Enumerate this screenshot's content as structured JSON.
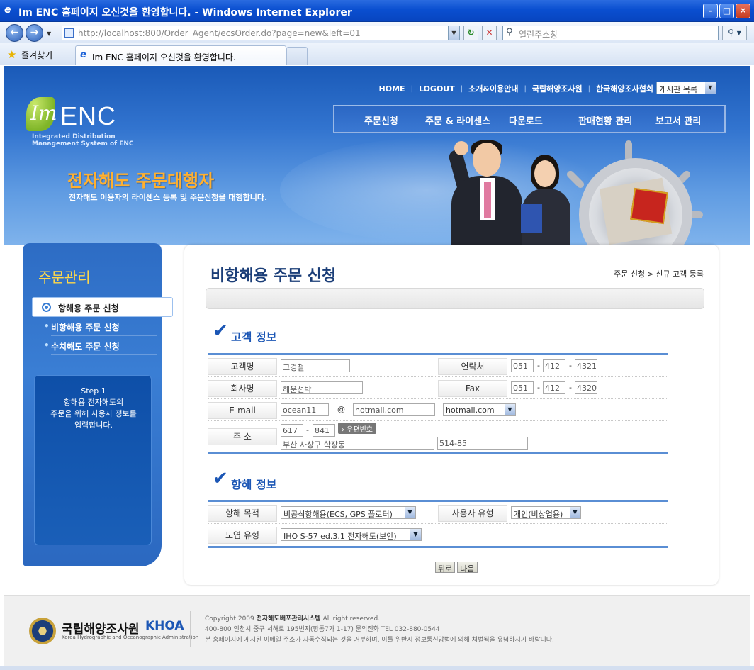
{
  "window": {
    "title": "Im ENC 홈페이지 오신것을 환영합니다. - Windows Internet Explorer"
  },
  "addressbar": {
    "url": "http://localhost:800/Order_Agent/ecsOrder.do?page=new&left=01",
    "search_placeholder": "열린주소창"
  },
  "favbar": {
    "favorites_label": "즐겨찾기",
    "tab_title": "Im ENC 홈페이지 오신것을 환영합니다."
  },
  "header": {
    "topnav": [
      "HOME",
      "LOGOUT",
      "소개&이용안내",
      "국립해양조사원",
      "한국해양조사협회"
    ],
    "board_select": "게시판 목록",
    "logo_im": "Im",
    "logo_enc": "ENC",
    "logo_sub_line1": "Integrated Distribution",
    "logo_sub_line2": "Management System of ENC",
    "menu": [
      "주문신청",
      "주문 & 라이센스",
      "다운로드",
      "판매현황 관리",
      "보고서 관리"
    ],
    "hero_title": "전자해도 주문대행자",
    "hero_subtitle": "전자해도 이용자의 라이센스 등록 및 주문신청을 대행합니다."
  },
  "sidebar": {
    "title": "주문관리",
    "active_item": "항해용 주문 신청",
    "items": [
      "비항해용 주문 신청",
      "수치해도 주문 신청"
    ],
    "step_box": {
      "line1": "Step 1",
      "line2": "항해용 전자해도의",
      "line3": "주문을 위해 사용자 정보를",
      "line4": "입력합니다."
    }
  },
  "content": {
    "page_title": "비항해용 주문 신청",
    "breadcrumb": {
      "first": "주문 신청",
      "arrow": ">",
      "second": "신규 고객 등록"
    },
    "customer_section": {
      "heading": "고객 정보",
      "name_label": "고객명",
      "name_value": "고경철",
      "contact_label": "연락처",
      "contact_1": "051",
      "contact_2": "412",
      "contact_3": "4321",
      "company_label": "회사명",
      "company_value": "해운선박",
      "fax_label": "Fax",
      "fax_1": "051",
      "fax_2": "412",
      "fax_3": "4320",
      "email_label": "E-mail",
      "email_id": "ocean11",
      "email_at": "@",
      "email_domain": "hotmail.com",
      "email_select": "hotmail.com",
      "address_label": "주 소",
      "zip_1": "617",
      "zip_2": "841",
      "zip_button": "› 우편번호",
      "address_1": "부산 사상구 학장동",
      "address_2": "514-85",
      "dash": "-"
    },
    "voyage_section": {
      "heading": "항해 정보",
      "purpose_label": "항해 목적",
      "purpose_value": "비공식항해용(ECS, GPS 플로터)",
      "usertype_label": "사용자 유형",
      "usertype_value": "개인(비상업용)",
      "chart_label": "도엽 유형",
      "chart_value": "IHO S-57 ed.3.1 전자해도(보안)"
    },
    "buttons": {
      "back": "뒤로",
      "next": "다음"
    }
  },
  "footer": {
    "org_name": "국립해양조사원",
    "org_abbr": "KHOA",
    "org_english": "Korea Hydrographic and Oceanographic Administration",
    "copyright_prefix": "Copyright  2009",
    "copyright_system": "전자해도배포관리시스템",
    "copyright_suffix": "All right reserved.",
    "address": "400-800 인천시 중구 서해로 195번지(항동7가 1-17)  문의전화 TEL 032-880-0544",
    "notice": "본 홈페이지에 게시된 이메일 주소가 자동수집되는 것을 거부하며, 이를 위반시 정보통신망법에 의해 처벌됨을 유념하시기 바랍니다."
  }
}
